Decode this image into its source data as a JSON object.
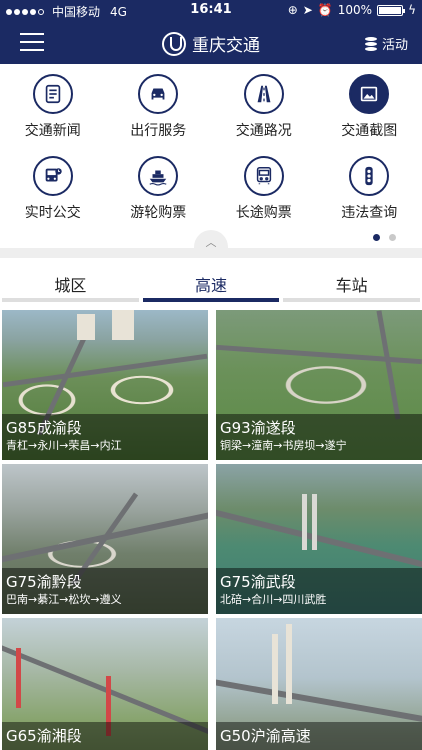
{
  "status_bar": {
    "carrier": "中国移动",
    "network": "4G",
    "time": "16:41",
    "battery": "100%"
  },
  "nav": {
    "title": "重庆交通",
    "activity_label": "活动"
  },
  "grid_items": [
    {
      "label": "交通新闻",
      "icon": "news-icon"
    },
    {
      "label": "出行服务",
      "icon": "car-icon"
    },
    {
      "label": "交通路况",
      "icon": "road-icon"
    },
    {
      "label": "交通截图",
      "icon": "image-icon"
    },
    {
      "label": "实时公交",
      "icon": "bus-icon"
    },
    {
      "label": "游轮购票",
      "icon": "ship-icon"
    },
    {
      "label": "长途购票",
      "icon": "coach-icon"
    },
    {
      "label": "违法查询",
      "icon": "traffic-light-icon"
    }
  ],
  "pager": {
    "pages": 2,
    "current": 1
  },
  "tabs": [
    {
      "label": "城区",
      "active": false
    },
    {
      "label": "高速",
      "active": true
    },
    {
      "label": "车站",
      "active": false
    }
  ],
  "cards": [
    {
      "title": "G85成渝段",
      "route": "青杠→永川→荣昌→内江"
    },
    {
      "title": "G93渝遂段",
      "route": "铜梁→潼南→书房坝→遂宁"
    },
    {
      "title": "G75渝黔段",
      "route": "巴南→綦江→松坎→遵义"
    },
    {
      "title": "G75渝武段",
      "route": "北碚→合川→四川武胜"
    },
    {
      "title": "G65渝湘段",
      "route": ""
    },
    {
      "title": "G50沪渝高速",
      "route": ""
    }
  ],
  "colors": {
    "brand": "#1b2a63",
    "tab_inactive": "#dedede",
    "divider": "#eeeeee"
  }
}
